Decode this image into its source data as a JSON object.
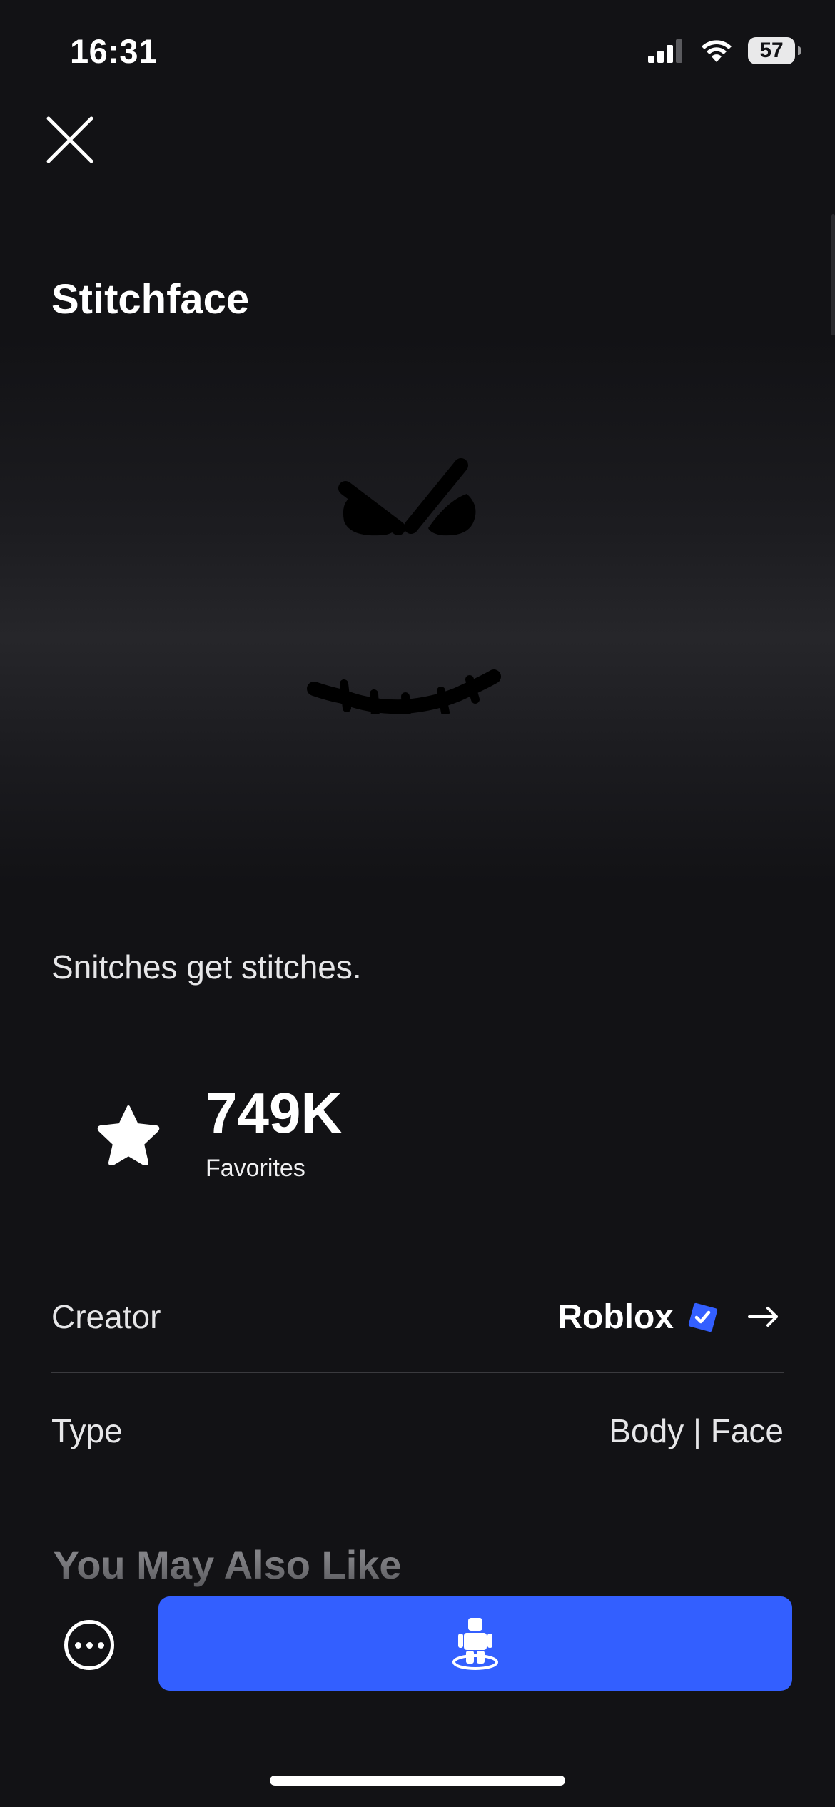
{
  "status_bar": {
    "time": "16:31",
    "battery": "57",
    "icons": [
      "signal-icon",
      "wifi-icon",
      "battery-icon"
    ]
  },
  "header": {
    "close_icon": "close-icon"
  },
  "item": {
    "title": "Stitchface",
    "description": "Snitches get stitches.",
    "favorites": {
      "count": "749K",
      "label": "Favorites",
      "icon": "star-icon"
    }
  },
  "details": {
    "creator_label": "Creator",
    "creator_name": "Roblox",
    "creator_verified_icon": "verified-badge-icon",
    "creator_arrow_icon": "arrow-right-icon",
    "type_label": "Type",
    "type_value": "Body | Face"
  },
  "recommendations": {
    "title": "You May Also Like"
  },
  "actions": {
    "more_icon": "more-options-icon",
    "try_on_icon": "avatar-try-on-icon"
  },
  "colors": {
    "background": "#121215",
    "accent": "#335fff",
    "verified": "#335fff"
  }
}
